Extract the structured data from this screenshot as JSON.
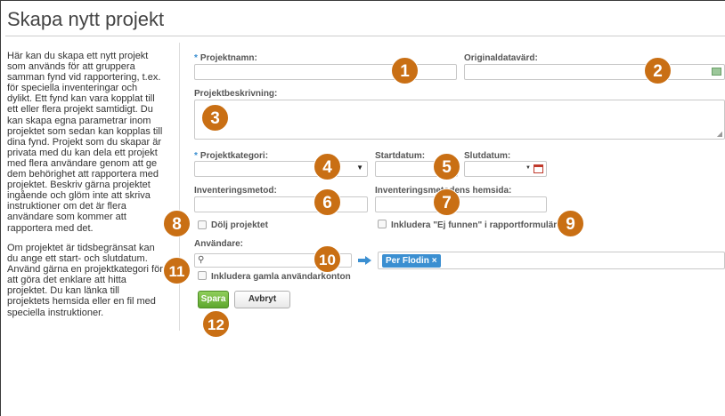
{
  "page": {
    "title": "Skapa nytt projekt"
  },
  "help": {
    "paragraph1": "Här kan du skapa ett nytt projekt som används för att gruppera samman fynd vid rapportering, t.ex. för speciella inventeringar och dylikt. Ett fynd kan vara kopplat till ett eller flera projekt samtidigt. Du kan skapa egna parametrar inom projektet som sedan kan kopplas till dina fynd. Projekt som du skapar är privata med du kan dela ett projekt med flera användare genom att ge dem behörighet att rapportera med projektet. Beskriv gärna projektet ingående och glöm inte att skriva instruktioner om det är flera användare som kommer att rapportera med det.",
    "paragraph2": "Om projektet är tidsbegränsat kan du ange ett start- och slutdatum. Använd gärna en projektkategori för att göra det enklare att hitta projektet. Du kan länka till projektets hemsida eller en fil med speciella instruktioner."
  },
  "form": {
    "required_mark": "*",
    "project_name_label": "Projektnamn:",
    "project_name_value": "",
    "original_host_label": "Originaldatavärd:",
    "original_host_value": "",
    "description_label": "Projektbeskrivning:",
    "description_value": "",
    "category_label": "Projektkategori:",
    "category_value": "",
    "start_date_label": "Startdatum:",
    "start_date_value": "",
    "end_date_label": "Slutdatum:",
    "end_date_value": "",
    "inventory_method_label": "Inventeringsmetod:",
    "inventory_method_value": "",
    "inventory_site_label": "Inventeringsmetodens hemsida:",
    "inventory_site_value": "",
    "hide_project_label": "Dölj projektet",
    "hide_project_checked": false,
    "include_not_found_label": "Inkludera \"Ej funnen\" i rapportformuläret",
    "include_not_found_checked": false,
    "users_label": "Användare:",
    "user_search_value": "",
    "selected_users": [
      {
        "name": "Per Flodin",
        "remove": "×"
      }
    ],
    "include_old_accounts_label": "Inkludera gamla användarkonton",
    "include_old_accounts_checked": false
  },
  "buttons": {
    "save": "Spara",
    "cancel": "Avbryt"
  },
  "badges": [
    "1",
    "2",
    "3",
    "4",
    "5",
    "6",
    "7",
    "8",
    "9",
    "10",
    "11",
    "12"
  ],
  "icons": {
    "search": "search-icon",
    "add_arrow": "arrow-right-icon",
    "calendar": "calendar-icon",
    "dropdown": "chevron-down-icon",
    "database": "database-icon",
    "resize": "resize-handle-icon"
  },
  "colors": {
    "accent_blue": "#3b8fd1",
    "badge_orange": "#c96f14",
    "save_green": "#5ea72e",
    "calendar_red": "#c0392b"
  }
}
